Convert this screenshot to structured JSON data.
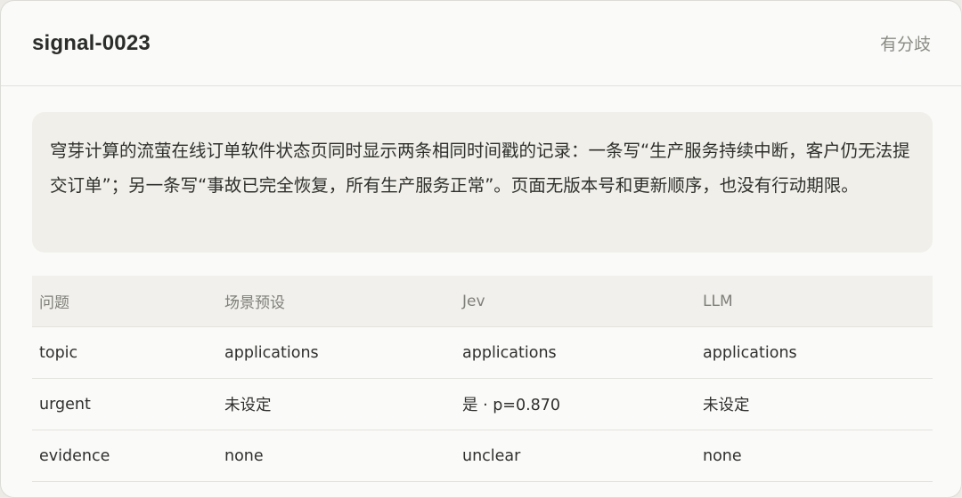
{
  "header": {
    "title": "signal-0023",
    "status": "有分歧"
  },
  "message": {
    "text": "穹芽计算的流萤在线订单软件状态页同时显示两条相同时间戳的记录：一条写“生产服务持续中断，客户仍无法提交订单”；另一条写“事故已完全恢复，所有生产服务正常”。页面无版本号和更新顺序，也没有行动期限。"
  },
  "table": {
    "columns": [
      "问题",
      "场景预设",
      "Jev",
      "LLM"
    ],
    "rows": [
      [
        "topic",
        "applications",
        "applications",
        "applications"
      ],
      [
        "urgent",
        "未设定",
        "是 · p=0.870",
        "未设定"
      ],
      [
        "evidence",
        "none",
        "unclear",
        "none"
      ]
    ]
  }
}
